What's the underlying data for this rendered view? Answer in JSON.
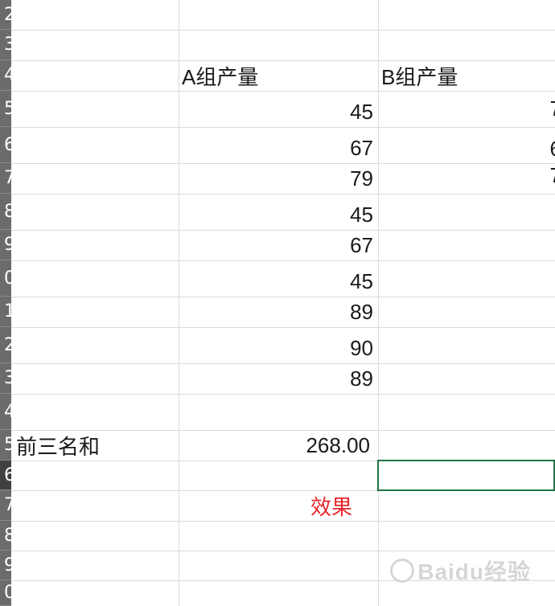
{
  "spreadsheet": {
    "row_numbers": [
      "2",
      "3",
      "4",
      "5",
      "6",
      "7",
      "8",
      "9",
      "0",
      "1",
      "2",
      "3",
      "4",
      "5",
      "6",
      "7",
      "8",
      "9",
      "0"
    ],
    "cells": {
      "a_header": "A组产量",
      "b_header": "B组产量",
      "a_values": [
        "45",
        "67",
        "79",
        "45",
        "67",
        "45",
        "89",
        "90",
        "89"
      ],
      "b_values_partial": [
        "7",
        "6",
        "7"
      ],
      "top3_label": "前三名和",
      "top3_value": "268.00",
      "effect_label": "效果"
    },
    "accent_colors": {
      "selection": "#217346",
      "effect_text": "#e8262e"
    }
  },
  "watermark": {
    "text": "Baidu经验"
  }
}
